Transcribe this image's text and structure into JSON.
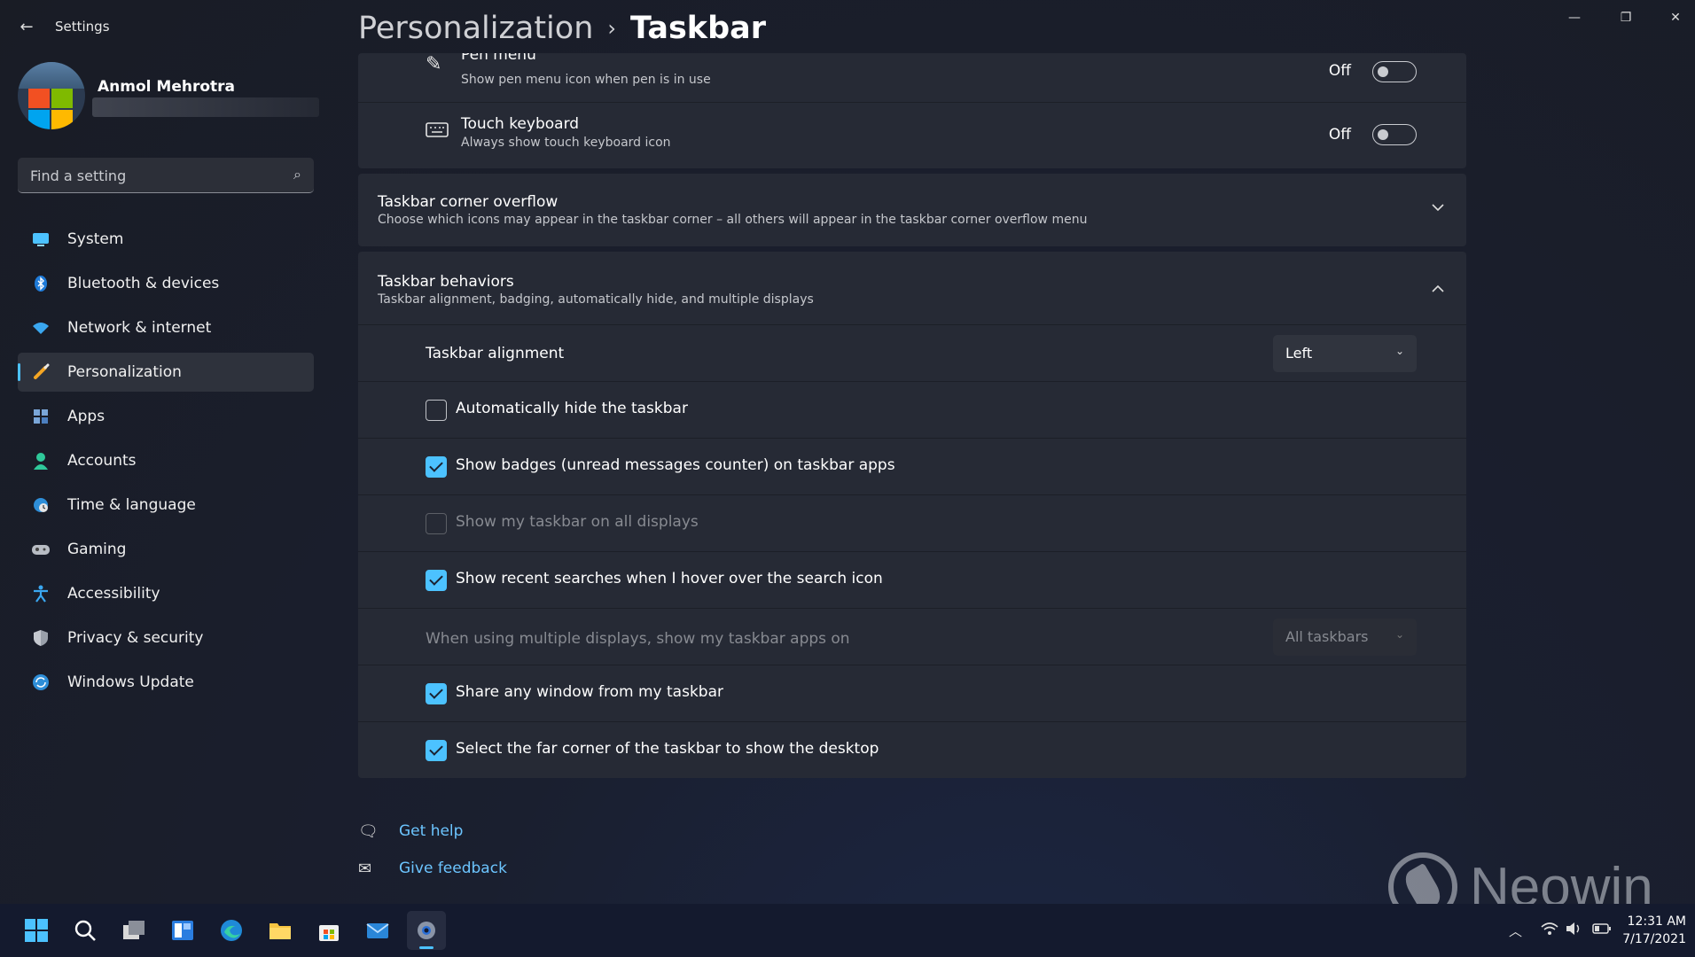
{
  "window": {
    "app_title": "Settings",
    "minimize": "—",
    "restore": "❐",
    "close": "✕"
  },
  "header": {
    "parent": "Personalization",
    "separator": "›",
    "current": "Taskbar"
  },
  "profile": {
    "name": "Anmol Mehrotra"
  },
  "search": {
    "placeholder": "Find a setting"
  },
  "sidebar": {
    "items": [
      {
        "label": "System",
        "icon": "monitor-icon",
        "active": false
      },
      {
        "label": "Bluetooth & devices",
        "icon": "bluetooth-icon",
        "active": false
      },
      {
        "label": "Network & internet",
        "icon": "wifi-icon",
        "active": false
      },
      {
        "label": "Personalization",
        "icon": "brush-icon",
        "active": true
      },
      {
        "label": "Apps",
        "icon": "apps-icon",
        "active": false
      },
      {
        "label": "Accounts",
        "icon": "person-icon",
        "active": false
      },
      {
        "label": "Time & language",
        "icon": "globe-clock-icon",
        "active": false
      },
      {
        "label": "Gaming",
        "icon": "gamepad-icon",
        "active": false
      },
      {
        "label": "Accessibility",
        "icon": "accessibility-icon",
        "active": false
      },
      {
        "label": "Privacy & security",
        "icon": "shield-icon",
        "active": false
      },
      {
        "label": "Windows Update",
        "icon": "update-icon",
        "active": false
      }
    ]
  },
  "corner_icons": {
    "pen_menu": {
      "title": "Pen menu",
      "subtitle": "Show pen menu icon when pen is in use",
      "state": "Off"
    },
    "touch_keyboard": {
      "title": "Touch keyboard",
      "subtitle": "Always show touch keyboard icon",
      "state": "Off"
    }
  },
  "corner_overflow": {
    "title": "Taskbar corner overflow",
    "subtitle": "Choose which icons may appear in the taskbar corner – all others will appear in the taskbar corner overflow menu"
  },
  "behaviors": {
    "title": "Taskbar behaviors",
    "subtitle": "Taskbar alignment, badging, automatically hide, and multiple displays",
    "alignment_label": "Taskbar alignment",
    "alignment_value": "Left",
    "auto_hide": {
      "label": "Automatically hide the taskbar",
      "checked": false
    },
    "badges": {
      "label": "Show badges (unread messages counter) on taskbar apps",
      "checked": true
    },
    "all_displays": {
      "label": "Show my taskbar on all displays",
      "checked": false,
      "disabled": true
    },
    "recent_searches": {
      "label": "Show recent searches when I hover over the search icon",
      "checked": true
    },
    "multi_display_label": "When using multiple displays, show my taskbar apps on",
    "multi_display_value": "All taskbars",
    "share_window": {
      "label": "Share any window from my taskbar",
      "checked": true
    },
    "far_corner": {
      "label": "Select the far corner of the taskbar to show the desktop",
      "checked": true
    }
  },
  "links": {
    "help": "Get help",
    "feedback": "Give feedback"
  },
  "watermark": {
    "text": "Neowin"
  },
  "taskbar": {
    "time": "12:31 AM",
    "date": "7/17/2021"
  },
  "colors": {
    "accent": "#4cc2ff",
    "background": "#1a1f2f",
    "card": "#262a35",
    "link": "#6cc5ff"
  }
}
